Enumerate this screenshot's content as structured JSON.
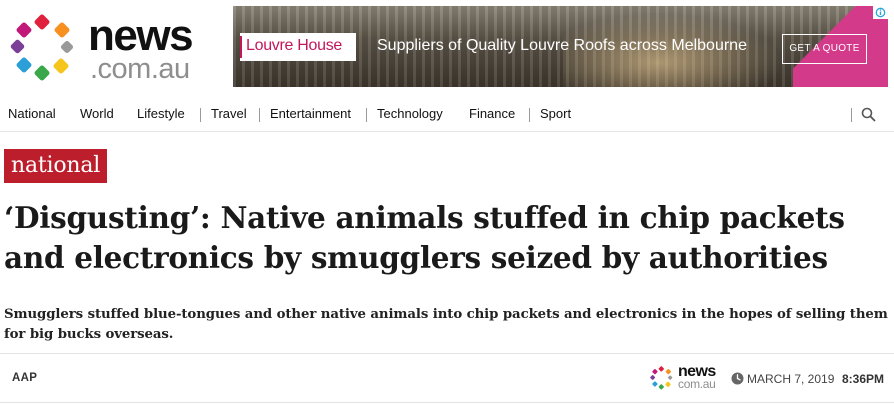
{
  "site": {
    "logo_word": "news",
    "logo_domain": ".com.au",
    "icon": "news-dots-logo"
  },
  "ad": {
    "brand": "Louvre House",
    "headline": "Suppliers of Quality Louvre Roofs across Melbourne",
    "cta": "GET A QUOTE",
    "choices_icon": "adchoices-icon",
    "colors": {
      "brand": "#c2185b",
      "accent": "#d43a8a"
    }
  },
  "nav": {
    "items": [
      {
        "label": "National"
      },
      {
        "label": "World"
      },
      {
        "label": "Lifestyle"
      },
      {
        "label": "Travel"
      },
      {
        "label": "Entertainment"
      },
      {
        "label": "Technology"
      },
      {
        "label": "Finance"
      },
      {
        "label": "Sport"
      }
    ],
    "search_icon": "search-icon"
  },
  "article": {
    "section": "national",
    "headline": "‘Disgusting’: Native animals stuffed in chip packets and electronics by smugglers seized by authorities",
    "standfirst": "Smugglers stuffed blue-tongues and other native animals into chip packets and electronics in the hopes of selling them for big bucks overseas.",
    "source": "AAP",
    "date": "MARCH 7, 2019",
    "time": "8:36PM",
    "mini_logo_word": "news",
    "mini_logo_domain": "com.au",
    "clock_icon": "clock-icon"
  },
  "colors": {
    "section_red": "#bd1e2c",
    "dot_red": "#e0213d",
    "dot_orange": "#f7901e",
    "dot_yellow": "#f6c51c",
    "dot_green": "#3aa84a",
    "dot_blue": "#2a9fd8",
    "dot_purple": "#7b3f98",
    "dot_magenta": "#c2187a",
    "dot_grey": "#9a9a9a"
  }
}
